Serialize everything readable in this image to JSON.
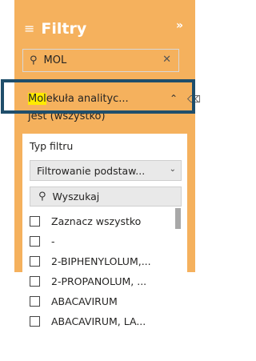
{
  "header": {
    "title": "Filtry",
    "filter_icon": "filter-lines-icon",
    "collapse_icon": "chevron-right-double-icon"
  },
  "search": {
    "value": "MOL",
    "icon": "search-icon",
    "clear_icon": "close-icon"
  },
  "filter_card": {
    "title_highlight": "Mol",
    "title_rest": "ekuła analityc...",
    "subtitle": "jest (wszystko)",
    "collapse_icon": "chevron-up-icon",
    "clear_icon": "eraser-icon"
  },
  "filter_panel": {
    "type_label": "Typ filtru",
    "type_value": "Filtrowanie podstaw...",
    "search_placeholder": "Wyszukaj",
    "items": [
      {
        "label": "Zaznacz wszystko",
        "checked": false
      },
      {
        "label": "-",
        "checked": false
      },
      {
        "label": "2-BIPHENYLOLUM,...",
        "checked": false
      },
      {
        "label": "2-PROPANOLUM, ...",
        "checked": false
      },
      {
        "label": "ABACAVIRUM",
        "checked": false
      },
      {
        "label": "ABACAVIRUM, LA...",
        "checked": false
      }
    ]
  },
  "colors": {
    "pane_background": "#f5b15d",
    "highlight": "#ffeb00",
    "outline": "#1f4e6b"
  }
}
